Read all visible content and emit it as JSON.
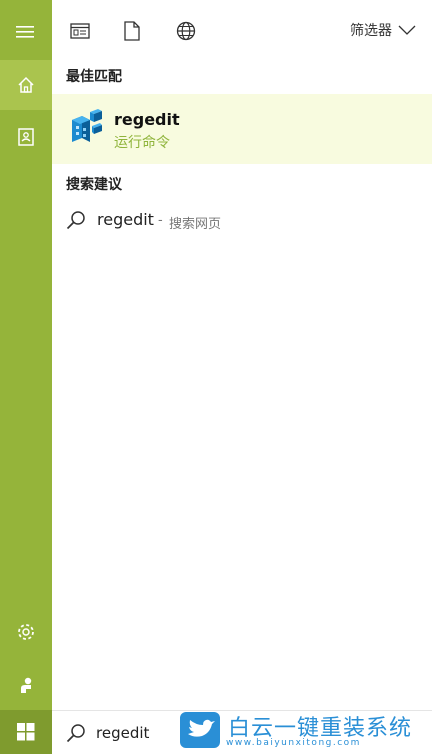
{
  "toolbar": {
    "filter_label": "筛选器"
  },
  "sections": {
    "best_match_title": "最佳匹配",
    "suggestions_title": "搜索建议"
  },
  "best_match": {
    "name": "regedit",
    "subtitle": "运行命令"
  },
  "suggestion": {
    "term": "regedit",
    "separator": "-",
    "suffix": "搜索网页"
  },
  "search": {
    "value": "regedit"
  },
  "watermark": {
    "title": "白云一键重装系统",
    "url": "www.baiyunxitong.com"
  },
  "colors": {
    "rail": "#95b43a",
    "accent": "#8fb43b",
    "highlight": "#f8fbdf",
    "brand_blue": "#2a8fd6"
  }
}
